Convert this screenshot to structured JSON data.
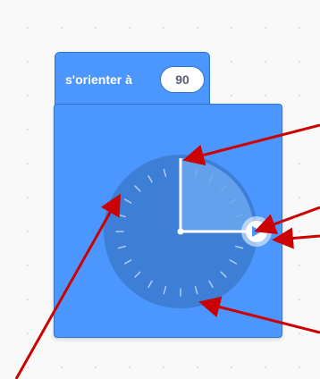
{
  "block": {
    "label": "s'orienter à",
    "value": "90"
  },
  "dial": {
    "direction_degrees": 90,
    "colors": {
      "panel": "#4c97ff",
      "panel_border": "#3373cc",
      "dial_face": "#3d7fd6",
      "wedge": "#6aa7f0",
      "handle": "#ffffff",
      "arrows": "#cc0000"
    }
  },
  "annotations": {
    "arrow_count": 5,
    "color": "#cc0000"
  },
  "icons": {
    "handle": "rotate-arrow-icon"
  }
}
